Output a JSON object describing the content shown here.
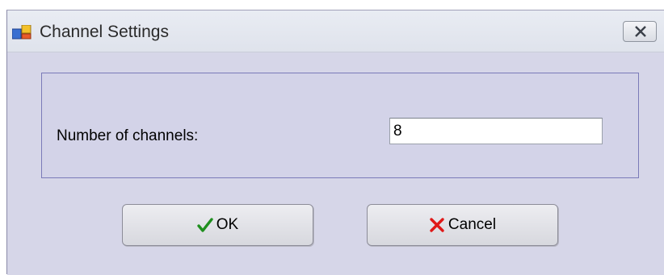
{
  "window": {
    "title": "Channel Settings",
    "icon": "app-window-icon",
    "close_icon": "close-icon"
  },
  "form": {
    "channels_label": "Number of channels:",
    "channels_value": "8"
  },
  "buttons": {
    "ok_label": "OK",
    "ok_icon": "checkmark-icon",
    "cancel_label": "Cancel",
    "cancel_icon": "x-mark-icon"
  },
  "colors": {
    "background": "#d6d6e8",
    "group_border": "#7a7ab8",
    "check_green": "#1f8f1f",
    "cancel_red": "#e01818"
  }
}
